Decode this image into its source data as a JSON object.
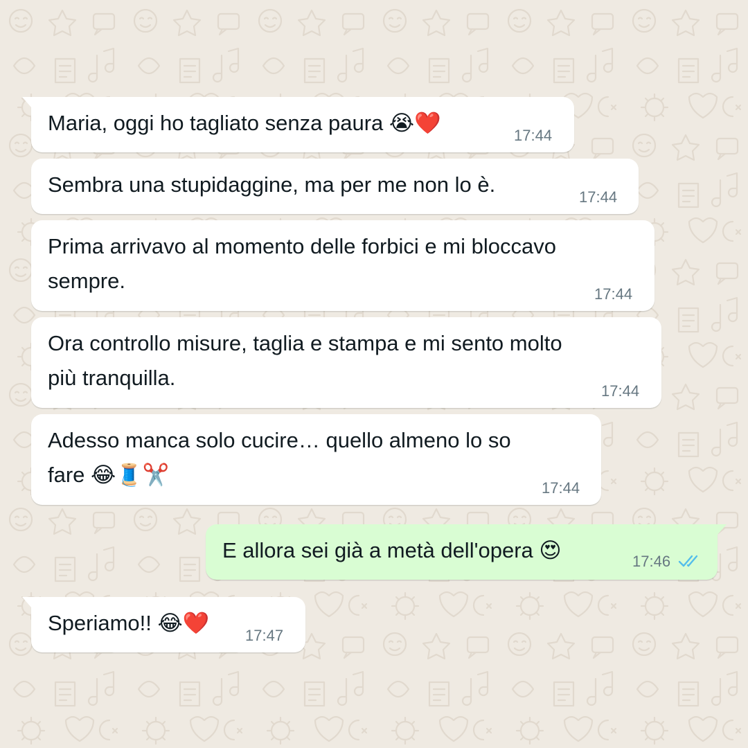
{
  "chat": {
    "messages": [
      {
        "direction": "incoming",
        "lines": [
          "Maria, oggi ho tagliato senza paura 😭❤️"
        ],
        "time": "17:44"
      },
      {
        "direction": "incoming",
        "lines": [
          "Sembra una stupidaggine, ma per me non lo è."
        ],
        "time": "17:44"
      },
      {
        "direction": "incoming",
        "lines": [
          "Prima arrivavo al momento delle forbici e mi bloccavo",
          "sempre."
        ],
        "time": "17:44"
      },
      {
        "direction": "incoming",
        "lines": [
          "Ora controllo misure, taglia e stampa e mi sento molto",
          "più tranquilla."
        ],
        "time": "17:44"
      },
      {
        "direction": "incoming",
        "lines": [
          "Adesso manca solo cucire… quello almeno lo so",
          "fare 😂🧵✂️"
        ],
        "time": "17:44"
      },
      {
        "direction": "outgoing",
        "lines": [
          "E allora sei già a metà dell'opera 😍"
        ],
        "time": "17:46",
        "status": "read"
      },
      {
        "direction": "incoming",
        "lines": [
          "Speriamo!! 😂❤️"
        ],
        "time": "17:47"
      }
    ]
  },
  "icons": {
    "read_receipt": "double-check-icon"
  },
  "colors": {
    "background": "#efeae2",
    "incoming_bubble": "#ffffff",
    "outgoing_bubble": "#d9fdd3",
    "text": "#111b21",
    "timestamp": "#667781",
    "read_ticks": "#53bdeb"
  }
}
